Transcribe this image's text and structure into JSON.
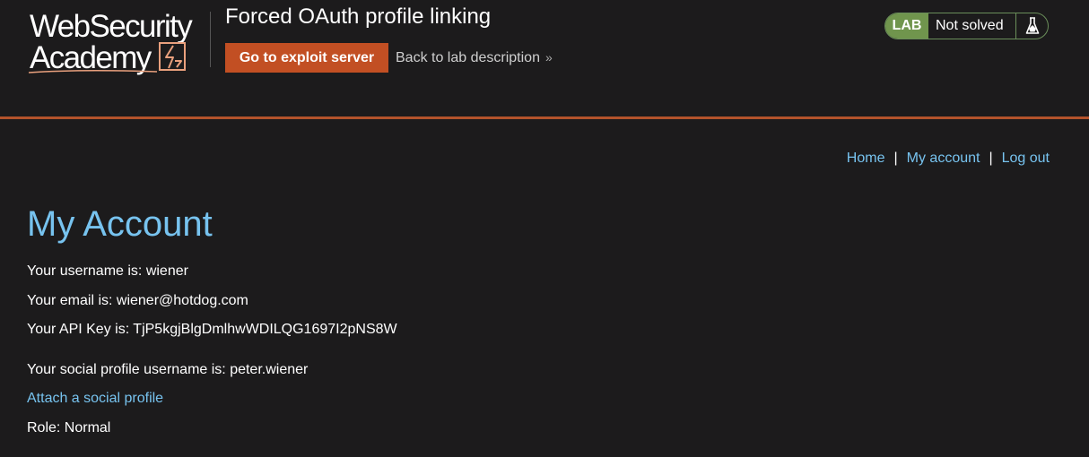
{
  "header": {
    "logo_line1": "WebSecurity",
    "logo_line2": "Academy",
    "lab_title": "Forced OAuth profile linking",
    "exploit_button": "Go to exploit server",
    "back_link": "Back to lab description",
    "lab_badge": "LAB",
    "lab_status": "Not solved"
  },
  "nav": {
    "home": "Home",
    "separator": "|",
    "my_account": "My account",
    "log_out": "Log out"
  },
  "account": {
    "title": "My Account",
    "username_line": "Your username is: wiener",
    "email_line": "Your email is: wiener@hotdog.com",
    "api_key_line": "Your API Key is: TjP5kgjBlgDmlhwWDILQG1697I2pNS8W",
    "social_line": "Your social profile username is: peter.wiener",
    "attach_link": "Attach a social profile",
    "role_line": "Role: Normal"
  },
  "colors": {
    "background": "#1c1b1c",
    "accent_orange": "#c24f23",
    "link_blue": "#77c3ef",
    "lab_green": "#70954d"
  },
  "icons": {
    "logo_mark": "lightning-bolt-icon",
    "back_chevron": "double-chevron-right-icon",
    "lab_flask": "flask-icon"
  }
}
